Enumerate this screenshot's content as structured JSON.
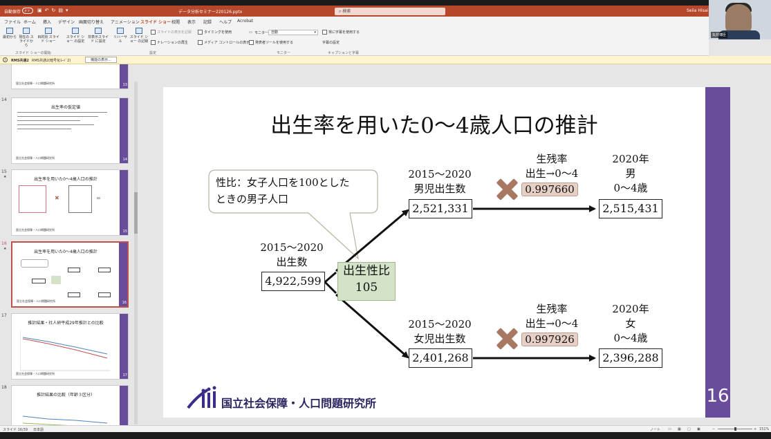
{
  "titlebar": {
    "autosave": "自動保存",
    "autosave_state": "オフ",
    "document": "データ分析セミナー220126.pptx",
    "search_placeholder": "検索",
    "user": "Seiia Hisai"
  },
  "tabs": [
    "ファイル",
    "ホーム",
    "挿入",
    "デザイン",
    "画面切り替え",
    "アニメーション",
    "スライド ショー",
    "校閲",
    "表示",
    "記録",
    "ヘルプ",
    "Acrobat"
  ],
  "ribbon": {
    "buttons": [
      "最初から",
      "現在の\nスライドから",
      "目的別\nスライド ショー",
      "スライド ショー\nの設定",
      "非表示スライド\nに設定",
      "リハーサル",
      "スライド ショー\nの記録"
    ],
    "checks": [
      "スライドの表示を記録",
      "タイミングを使用",
      "ナレーションの再生",
      "メディア コントロールの表示",
      "発表者ツールを使用する",
      "常に字幕を使用する",
      "字幕の設定"
    ],
    "monitor_label": "モニター:",
    "monitor_value": "自動",
    "groups": [
      "スライド ショーの開始",
      "設定",
      "モニター",
      "キャプションと字幕"
    ]
  },
  "webcam": {
    "name": "矢井博臣"
  },
  "infobar": {
    "title": "RMS共通2",
    "text": "RMS共通2(暗号化ﾓｰﾄﾞ2)",
    "button": "機能の表示..."
  },
  "thumbnails": [
    {
      "num": "",
      "title": "",
      "page": "13"
    },
    {
      "num": "14",
      "title": "出生率の仮定値",
      "page": "14",
      "star": ""
    },
    {
      "num": "15",
      "title": "出生率を用いた0〜4歳人口の推計",
      "page": "15",
      "star": "★"
    },
    {
      "num": "16",
      "title": "出生率を用いた0〜4歳人口の推計",
      "page": "16",
      "star": "★"
    },
    {
      "num": "17",
      "title": "推計結果・社人研平成29年推計との比較",
      "page": "17",
      "star": ""
    },
    {
      "num": "18",
      "title": "推計結果の比較（年齢３区分）",
      "page": "18",
      "star": ""
    }
  ],
  "thumb_footer": "国立社会保障・人口問題研究所",
  "slide": {
    "title": "出生率を用いた0〜4歳人口の推計",
    "page_number": "16",
    "callout": "性比：女子人口を100とした\nときの男子人口",
    "births_label": "2015〜2020\n出生数",
    "births_value": "4,922,599",
    "sex_ratio_label": "出生性比",
    "sex_ratio_value": "105",
    "male": {
      "births_label": "2015〜2020\n男児出生数",
      "births_value": "2,521,331",
      "survival_label": "生残率\n出生→0〜4",
      "survival_value": "0.997660",
      "result_label": "2020年\n男\n0〜4歳",
      "result_value": "2,515,431"
    },
    "female": {
      "births_label": "2015〜2020\n女児出生数",
      "births_value": "2,401,268",
      "survival_label": "生残率\n出生→0〜4",
      "survival_value": "0.997926",
      "result_label": "2020年\n女\n0〜4歳",
      "result_value": "2,396,288"
    },
    "institution": "国立社会保障・人口問題研究所"
  },
  "statusbar": {
    "slide": "スライド 16/39",
    "language": "日本語",
    "notes": "ノート",
    "zoom": "151%"
  },
  "colors": {
    "accent": "#b7472a",
    "slide_band": "#6a4c9c",
    "sex_ratio_box": "#d4e3c8",
    "survival_box": "#e6cfc4",
    "x_mark": "#a87863"
  }
}
